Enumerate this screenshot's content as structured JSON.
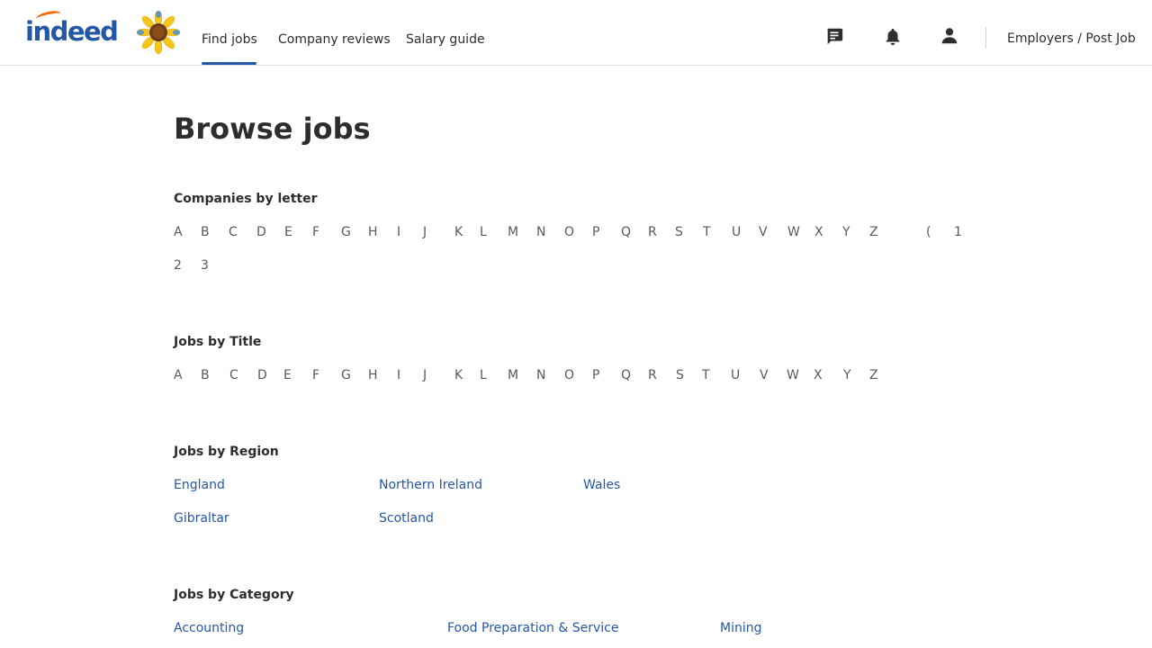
{
  "header": {
    "logo_text": "indeed",
    "nav": {
      "find_jobs": "Find jobs",
      "company_reviews": "Company reviews",
      "salary_guide": "Salary guide"
    },
    "employers_label": "Employers / Post Job",
    "icons": {
      "messages": "chat-bubble-icon",
      "notifications": "bell-icon",
      "profile": "person-icon"
    }
  },
  "main": {
    "title": "Browse jobs",
    "companies": {
      "heading": "Companies by letter",
      "row1": [
        "A",
        "B",
        "C",
        "D",
        "E",
        "F",
        "G",
        "H",
        "I",
        "J",
        "K",
        "L",
        "M",
        "N",
        "O",
        "P",
        "Q",
        "R",
        "S",
        "T",
        "U",
        "V",
        "W",
        "X",
        "Y",
        "Z",
        "(",
        "1"
      ],
      "row2": [
        "2",
        "3"
      ]
    },
    "titles": {
      "heading": "Jobs by Title",
      "letters": [
        "A",
        "B",
        "C",
        "D",
        "E",
        "F",
        "G",
        "H",
        "I",
        "J",
        "K",
        "L",
        "M",
        "N",
        "O",
        "P",
        "Q",
        "R",
        "S",
        "T",
        "U",
        "V",
        "W",
        "X",
        "Y",
        "Z"
      ]
    },
    "regions": {
      "heading": "Jobs by Region",
      "items": [
        "England",
        "Northern Ireland",
        "Wales",
        "Gibraltar",
        "Scotland"
      ]
    },
    "categories": {
      "heading": "Jobs by Category",
      "items": [
        "Accounting",
        "Food Preparation & Service",
        "Mining"
      ]
    }
  },
  "colors": {
    "brand_blue": "#2557a7",
    "text": "#2d2d2d",
    "muted": "#595959"
  }
}
